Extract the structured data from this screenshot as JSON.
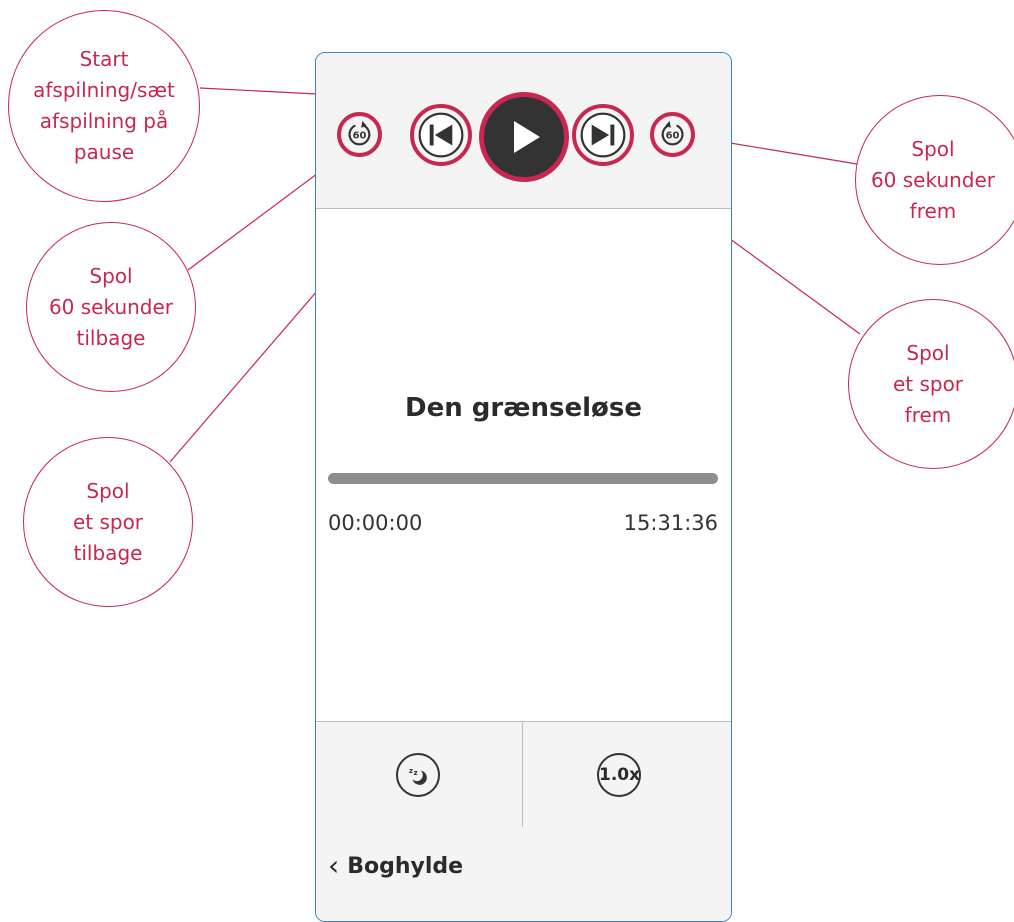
{
  "player": {
    "title": "Den grænseløse",
    "elapsed": "00:00:00",
    "duration": "15:31:36",
    "progress_fraction": 0,
    "speed_label": "1.0x",
    "rewind_seconds": "60",
    "forward_seconds": "60"
  },
  "nav": {
    "back_label": "Boghylde"
  },
  "callouts": {
    "play": [
      "Start",
      "afspilning/sæt",
      "afspilning på",
      "pause"
    ],
    "rewind": [
      "Spol",
      "60 sekunder",
      "tilbage"
    ],
    "prev": [
      "Spol",
      "et spor",
      "tilbage"
    ],
    "forward": [
      "Spol",
      "60 sekunder",
      "frem"
    ],
    "next": [
      "Spol",
      "et spor",
      "frem"
    ]
  },
  "colors": {
    "accent": "#c8284f",
    "phone_border": "#3b82c4",
    "icon_dark": "#333333",
    "panel": "#f4f4f4"
  },
  "icons": {
    "rewind": "rewind-60-icon",
    "previous": "skip-previous-icon",
    "play": "play-icon",
    "next": "skip-next-icon",
    "forward": "forward-60-icon",
    "sleep": "sleep-timer-icon",
    "back": "chevron-left-icon"
  }
}
